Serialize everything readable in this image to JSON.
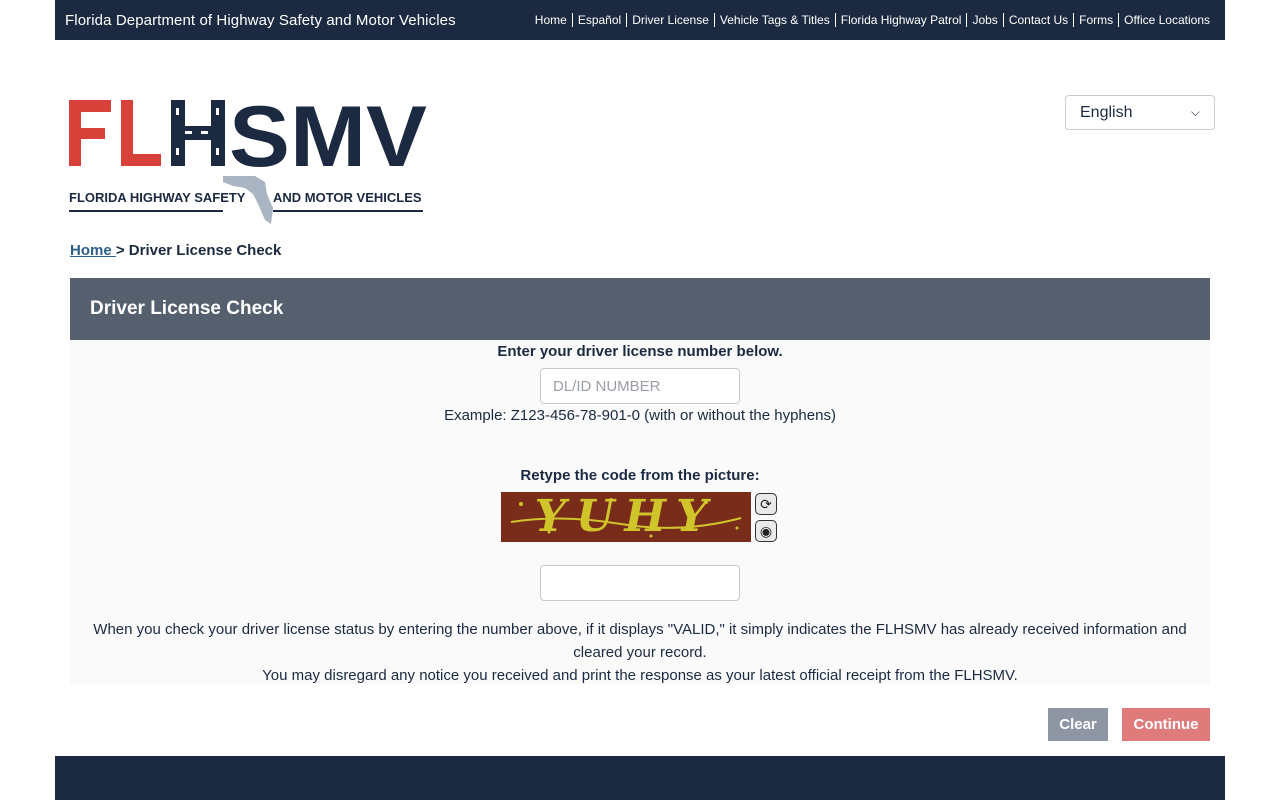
{
  "topbar": {
    "agency": "Florida Department of Highway Safety and Motor Vehicles",
    "nav": [
      "Home",
      "Español",
      "Driver License",
      "Vehicle Tags & Titles",
      "Florida Highway Patrol",
      "Jobs",
      "Contact Us",
      "Forms",
      "Office Locations"
    ]
  },
  "logo": {
    "letters": "FLHSMV",
    "tagline_left": "FLORIDA HIGHWAY SAFETY",
    "tagline_right": "AND MOTOR VEHICLES"
  },
  "language": {
    "selected": "English"
  },
  "breadcrumb": {
    "home": "Home ",
    "separator": "> ",
    "current": "Driver License Check"
  },
  "panel": {
    "title": "Driver License Check",
    "dl_label": "Enter your driver license number below.",
    "dl_placeholder": "DL/ID NUMBER",
    "example": "Example: Z123-456-78-901-0 (with or without the hyphens)",
    "code_label": "Retype the code from the picture:",
    "captcha_text": "YUHY",
    "notice_line1": "When you check your driver license status by entering the number above, if it displays \"VALID,\" it simply indicates the FLHSMV has already received information and cleared your record.",
    "notice_line2": "You may disregard any notice you received and print the response as your latest official receipt from the FLHSMV."
  },
  "buttons": {
    "clear": "Clear",
    "continue": "Continue"
  },
  "colors": {
    "navy": "#1b2a40",
    "red": "#d8403a",
    "panel_header": "#555f6e",
    "continue": "#e07b7b",
    "clear": "#8d96a2"
  },
  "icons": {
    "refresh": "refresh-icon",
    "audio": "audio-icon",
    "dropdown": "chevron-down-icon"
  }
}
